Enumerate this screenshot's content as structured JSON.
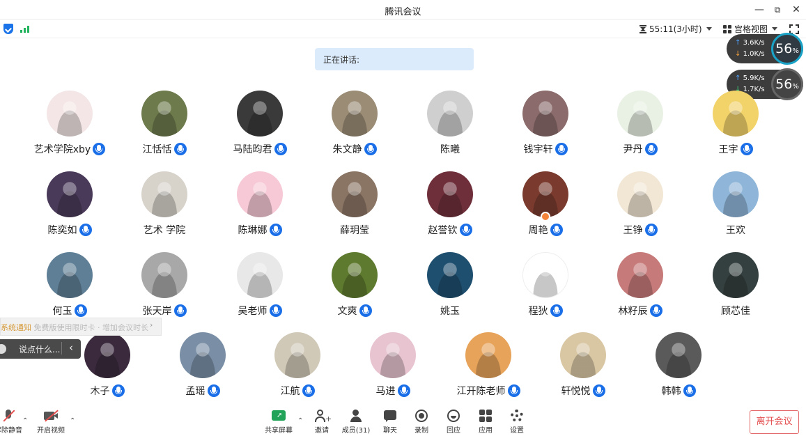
{
  "window": {
    "title": "腾讯会议",
    "minimize": "—",
    "restore": "⧉",
    "close": "✕"
  },
  "topbar": {
    "timer": "55:11(3小时)",
    "view_label": "宫格视图"
  },
  "speaking_label": "正在讲话:",
  "network": [
    {
      "up": "3.6K/s",
      "down": "1.0K/s",
      "percent": "56",
      "percent_sign": "%"
    },
    {
      "up": "5.9K/s",
      "down": "1.7K/s",
      "percent": "56",
      "percent_sign": "%"
    }
  ],
  "participants": [
    {
      "name": "艺术学院xby",
      "mic": true,
      "color": "#f4e6e6"
    },
    {
      "name": "江恬恬",
      "mic": true,
      "color": "#6d7a4b"
    },
    {
      "name": "马陆昀君",
      "mic": true,
      "color": "#3a3a3a"
    },
    {
      "name": "朱文静",
      "mic": true,
      "color": "#9b8c75"
    },
    {
      "name": "陈曦",
      "mic": false,
      "color": "#cfcfcf"
    },
    {
      "name": "钱宇轩",
      "mic": true,
      "color": "#8b6b6b"
    },
    {
      "name": "尹丹",
      "mic": true,
      "color": "#e9f1e4"
    },
    {
      "name": "王宇",
      "mic": true,
      "color": "#f2d36a"
    },
    {
      "name": "陈奕如",
      "mic": true,
      "color": "#4a3a5a"
    },
    {
      "name": "艺术 学院",
      "mic": false,
      "color": "#d7d3cb"
    },
    {
      "name": "陈琳娜",
      "mic": true,
      "color": "#f7c9d6"
    },
    {
      "name": "薛玥莹",
      "mic": false,
      "color": "#8a7464"
    },
    {
      "name": "赵誉钦",
      "mic": true,
      "color": "#6e2f3a"
    },
    {
      "name": "周艳",
      "mic": true,
      "color": "#7a3b2e",
      "host": true
    },
    {
      "name": "王铮",
      "mic": true,
      "color": "#f2e6d4"
    },
    {
      "name": "王欢",
      "mic": false,
      "color": "#8fb6d8"
    },
    {
      "name": "何玉",
      "mic": true,
      "color": "#5f7f96"
    },
    {
      "name": "张天岸",
      "mic": true,
      "color": "#a8a8a8"
    },
    {
      "name": "吴老师",
      "mic": true,
      "color": "#e8e8e8"
    },
    {
      "name": "文爽",
      "mic": true,
      "color": "#5e7a2e"
    },
    {
      "name": "姚玉",
      "mic": false,
      "color": "#1f4f6f"
    },
    {
      "name": "程狄",
      "mic": true,
      "color": "#ffffff"
    },
    {
      "name": "林籽辰",
      "mic": true,
      "color": "#c77a7a"
    },
    {
      "name": "顾芯佳",
      "mic": false,
      "color": "#34403f"
    },
    {
      "name": "木子",
      "mic": true,
      "color": "#3b2a3d"
    },
    {
      "name": "孟瑶",
      "mic": true,
      "color": "#7a8fa6"
    },
    {
      "name": "江航",
      "mic": true,
      "color": "#d1c9b8"
    },
    {
      "name": "马进",
      "mic": true,
      "color": "#e7c4cf"
    },
    {
      "name": "江开陈老师",
      "mic": true,
      "color": "#e7a35a"
    },
    {
      "name": "轩悦悦",
      "mic": true,
      "color": "#d9c7a4"
    },
    {
      "name": "韩韩",
      "mic": true,
      "color": "#5a5a5a"
    }
  ],
  "notice": {
    "title": "系统通知",
    "text": "免费版使用限时卡 · 增加会议时长",
    "arrow": "›"
  },
  "chat": {
    "placeholder": "说点什么...",
    "collapse": "‹"
  },
  "bottom": {
    "mute_label": "解除静音",
    "video_label": "开启视频",
    "share_label": "共享屏幕",
    "invite_label": "邀请",
    "members_label": "成员(31)",
    "chat_label": "聊天",
    "record_label": "录制",
    "react_label": "回应",
    "apps_label": "应用",
    "settings_label": "设置",
    "leave_label": "离开会议"
  },
  "colors": {
    "accent": "#1a6fe8",
    "leave": "#e34d4d",
    "speaking_bg": "#dcebfb"
  }
}
